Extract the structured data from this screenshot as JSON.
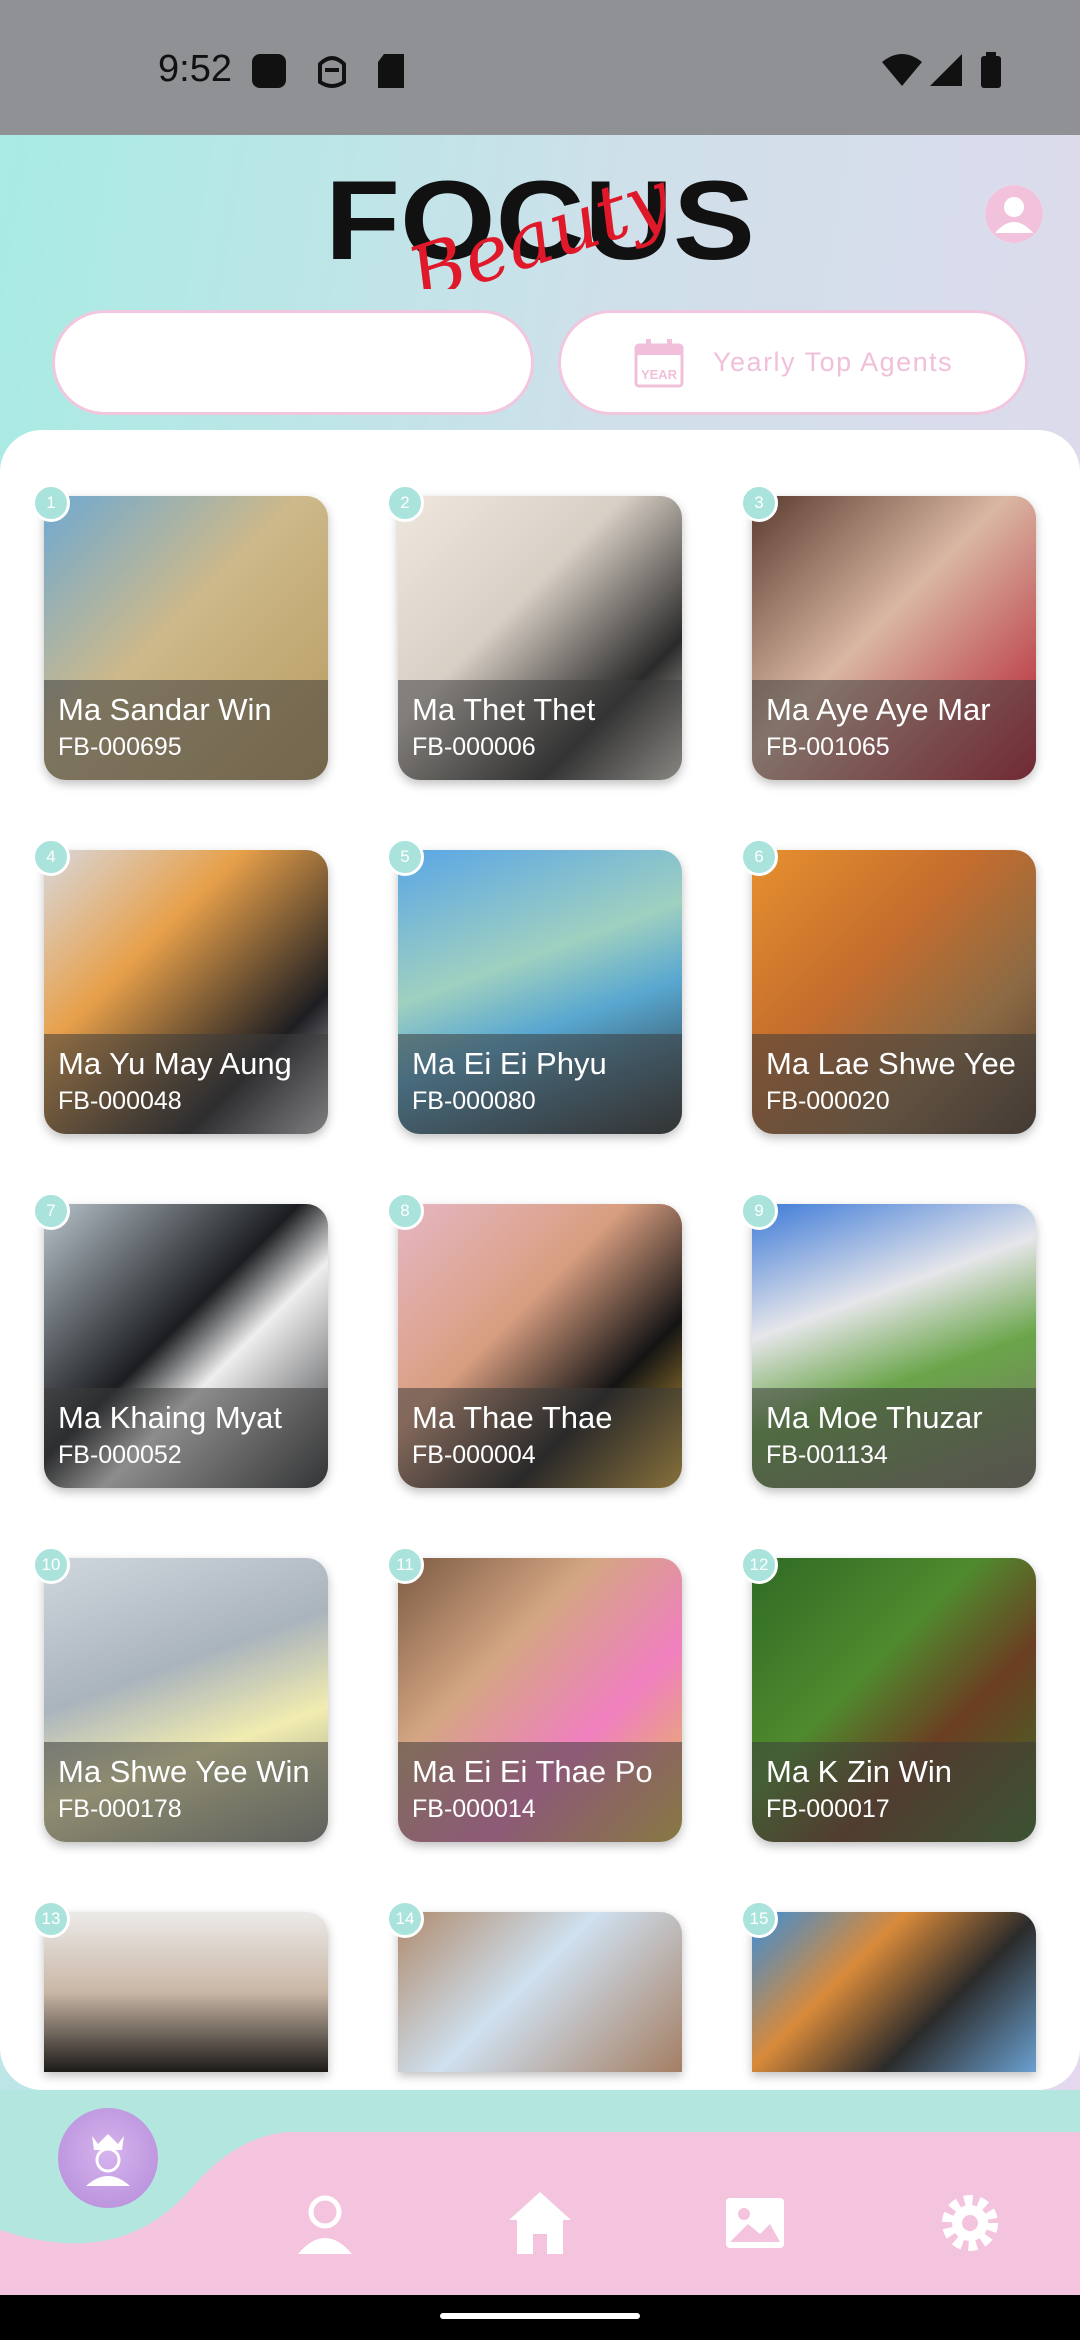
{
  "status_bar": {
    "time": "9:52"
  },
  "header": {
    "logo_word": "FOCUS",
    "logo_script": "Beauty"
  },
  "filters": {
    "search_value": "",
    "yearly_label": "Yearly  Top  Agents",
    "calendar_icon_text": "YEAR"
  },
  "agents": [
    {
      "rank": "1",
      "name": "Ma Sandar Win",
      "id": "FB-000695"
    },
    {
      "rank": "2",
      "name": "Ma Thet Thet",
      "id": "FB-000006"
    },
    {
      "rank": "3",
      "name": "Ma Aye Aye Mar",
      "id": "FB-001065"
    },
    {
      "rank": "4",
      "name": "Ma Yu May Aung",
      "id": "FB-000048"
    },
    {
      "rank": "5",
      "name": "Ma Ei Ei Phyu",
      "id": "FB-000080"
    },
    {
      "rank": "6",
      "name": "Ma Lae Shwe Yee",
      "id": "FB-000020"
    },
    {
      "rank": "7",
      "name": "Ma Khaing Myat",
      "id": "FB-000052"
    },
    {
      "rank": "8",
      "name": "Ma Thae Thae",
      "id": "FB-000004"
    },
    {
      "rank": "9",
      "name": "Ma Moe Thuzar",
      "id": "FB-001134"
    },
    {
      "rank": "10",
      "name": "Ma Shwe Yee Win",
      "id": "FB-000178"
    },
    {
      "rank": "11",
      "name": "Ma Ei Ei Thae Po",
      "id": "FB-000014"
    },
    {
      "rank": "12",
      "name": "Ma K Zin Win",
      "id": "FB-000017"
    },
    {
      "rank": "13",
      "name": "",
      "id": ""
    },
    {
      "rank": "14",
      "name": "",
      "id": ""
    },
    {
      "rank": "15",
      "name": "",
      "id": ""
    }
  ],
  "bottom_nav": {
    "items": [
      "crown-user",
      "profile",
      "home",
      "gallery",
      "settings"
    ]
  },
  "colors": {
    "accent_pink": "#f1bfd9",
    "rank_badge": "#a9e3dc",
    "nav_pink": "#f4c3dd",
    "nav_teal": "#b3e6df"
  }
}
